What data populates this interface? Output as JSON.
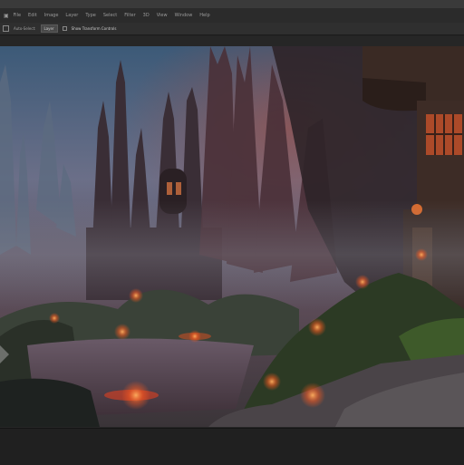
{
  "menubar": {
    "items": [
      "File",
      "Edit",
      "Image",
      "Layer",
      "Type",
      "Select",
      "Filter",
      "3D",
      "View",
      "Window",
      "Help"
    ]
  },
  "optionsbar": {
    "label": "Auto-Select:",
    "field_value": "Layer",
    "toggle_label": "Show Transform Controls"
  },
  "canvas": {
    "image_name": "fantasy-city-painting"
  },
  "colors": {
    "chrome_dark": "#232323",
    "menubar": "#2b2b2b",
    "optionsbar": "#2f2f2f",
    "ember_accent": "#ff5a1f"
  }
}
